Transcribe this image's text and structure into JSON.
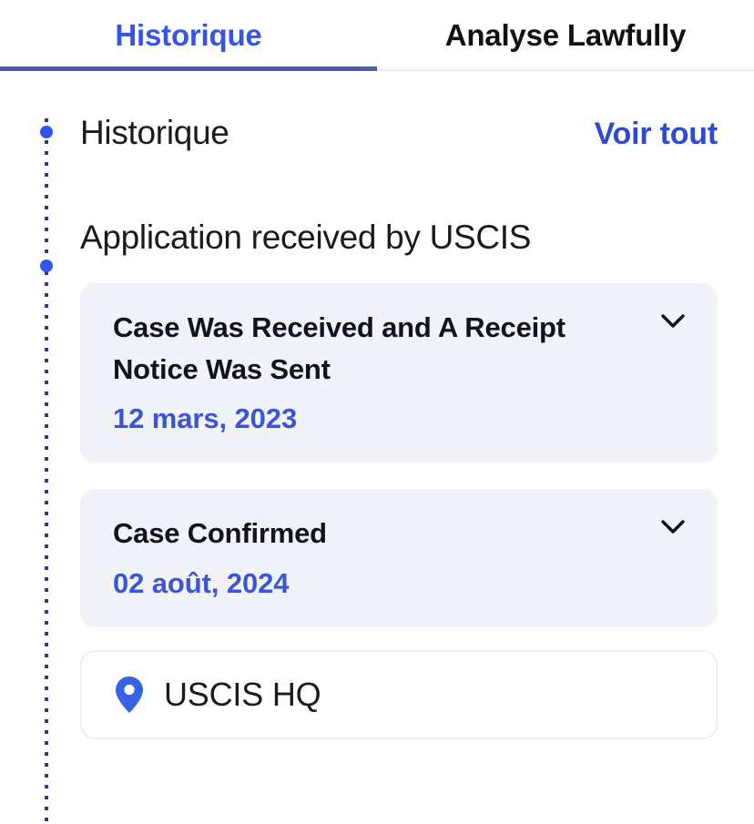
{
  "tabs": [
    {
      "label": "Historique",
      "active": true
    },
    {
      "label": "Analyse Lawfully",
      "active": false
    }
  ],
  "section": {
    "title": "Historique",
    "see_all_label": "Voir tout"
  },
  "stage": {
    "title": "Application received by USCIS"
  },
  "events": [
    {
      "title": "Case Was Received and A Receipt Notice Was Sent",
      "date": "12 mars, 2023",
      "expand_icon": "chevron-down-icon"
    },
    {
      "title": "Case Confirmed",
      "date": "02 août, 2024",
      "expand_icon": "chevron-down-icon"
    }
  ],
  "location": {
    "icon": "map-pin-icon",
    "label": "USCIS HQ"
  },
  "colors": {
    "accent_blue": "#3355ee",
    "link_blue": "#2c4ad8",
    "date_blue": "#3a55d9",
    "tab_underline": "#4a5fae",
    "card_bg": "#f1f3f9",
    "text_dark": "#1b1b1f",
    "divider": "#eceef3"
  }
}
